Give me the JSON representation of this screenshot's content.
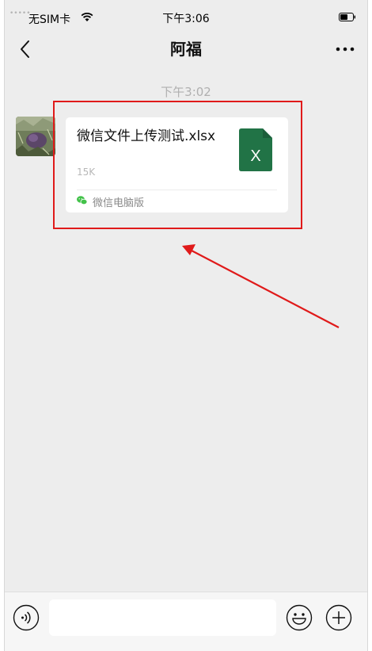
{
  "status_bar": {
    "signal": "•••••",
    "carrier": "无SIM卡",
    "time": "下午3:06"
  },
  "nav": {
    "title": "阿福"
  },
  "chat": {
    "timestamp": "下午3:02",
    "message": {
      "file_name": "微信文件上传测试.xlsx",
      "file_size": "15K",
      "file_icon_letter": "X",
      "file_icon_color": "#217346",
      "source": "微信电脑版",
      "source_icon_color": "#43c24a"
    }
  },
  "annotation": {
    "color": "#e01a1a"
  },
  "input_bar": {
    "placeholder": ""
  }
}
